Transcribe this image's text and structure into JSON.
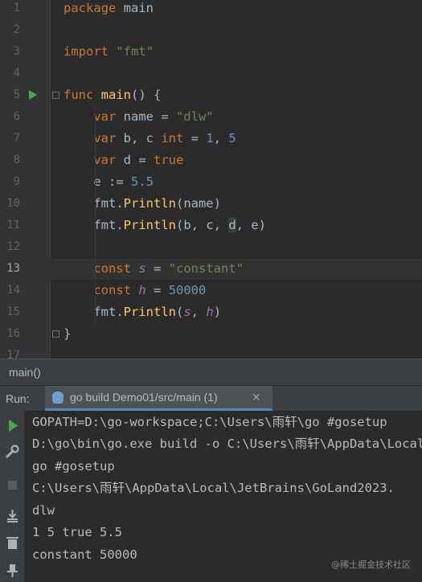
{
  "editor": {
    "line_numbers": [
      "1",
      "2",
      "3",
      "4",
      "5",
      "6",
      "7",
      "8",
      "9",
      "10",
      "11",
      "12",
      "13",
      "14",
      "15",
      "16",
      "17"
    ],
    "tokens": {
      "l1": [
        "package",
        " ",
        "main"
      ],
      "l3": [
        "import",
        " ",
        "\"fmt\""
      ],
      "l5": [
        "func",
        " ",
        "main",
        "() {"
      ],
      "l6": [
        "    ",
        "var",
        " name = ",
        "\"dlw\""
      ],
      "l7": [
        "    ",
        "var",
        " b, c ",
        "int",
        " = ",
        "1",
        ", ",
        "5"
      ],
      "l8": [
        "    ",
        "var",
        " d = ",
        "true"
      ],
      "l9": [
        "    e := ",
        "5.5"
      ],
      "l10": [
        "    fmt.",
        "Println",
        "(name)"
      ],
      "l11": [
        "    fmt.",
        "Println",
        "(b, c, ",
        "d",
        ", e)"
      ],
      "l13": [
        "    ",
        "const",
        " ",
        "s",
        " = ",
        "\"constant\""
      ],
      "l14": [
        "    ",
        "const",
        " ",
        "h",
        " = ",
        "50000"
      ],
      "l15": [
        "    fmt.",
        "Println",
        "(",
        "s",
        ", ",
        "h",
        ")"
      ],
      "l16": [
        "}"
      ]
    },
    "current_line": "13"
  },
  "breadcrumb": "main()",
  "run_panel": {
    "label": "Run:",
    "tab_label": "go build Demo01/src/main (1)",
    "close_glyph": "✕",
    "output": [
      "GOPATH=D:\\go-workspace;C:\\Users\\雨轩\\go #gosetup",
      "D:\\go\\bin\\go.exe build -o C:\\Users\\雨轩\\AppData\\Local\\Temp\\",
      "go #gosetup",
      "C:\\Users\\雨轩\\AppData\\Local\\JetBrains\\GoLand2023.",
      "dlw",
      "1 5 true 5.5",
      "constant 50000"
    ]
  },
  "toolbar_icons": [
    "play-icon",
    "wrench-icon",
    "stop-icon",
    "scroll-to-end-icon",
    "trash-icon",
    "pin-icon"
  ],
  "watermark": "@稀土掘金技术社区",
  "colors": {
    "editor_bg": "#2b2b2b",
    "keyword": "#cc7832",
    "string": "#6a8759",
    "number": "#6897bb",
    "function": "#ffc66d",
    "constant": "#9876aa",
    "run_green": "#4ea64f"
  }
}
